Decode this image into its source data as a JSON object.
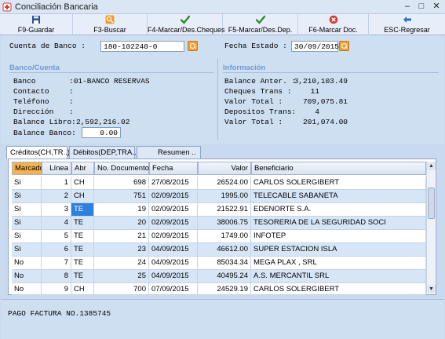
{
  "window": {
    "title": "Conciliación Bancaria",
    "minimize": "–",
    "maximize": "□",
    "close": "✕"
  },
  "toolbar": {
    "buttons": [
      {
        "label": "F9-Guardar",
        "icon": "save-icon",
        "color": "#2b4fa0"
      },
      {
        "label": "F3-Buscar",
        "icon": "search-icon",
        "color": "#f39c2a"
      },
      {
        "label": "F4-Marcar/Des.Cheques",
        "icon": "check-icon",
        "color": "#2f8a2f"
      },
      {
        "label": "F5-Marcar/Des.Dep.",
        "icon": "check-icon",
        "color": "#2f8a2f"
      },
      {
        "label": "F6-Marcar Doc.",
        "icon": "cancel-icon",
        "color": "#d33a2c"
      },
      {
        "label": "ESC-Regresar",
        "icon": "back-icon",
        "color": "#2d6ec7"
      }
    ]
  },
  "form": {
    "cuenta_label": "Cuenta de Banco  :",
    "cuenta_value": "180-102240-0",
    "fecha_label": "Fecha Estado   :",
    "fecha_value": "30/09/2015",
    "banco_section": "Banco/Cuenta",
    "info_section": "Información",
    "banco_fields": [
      {
        "label": "Banco",
        "value": ":01-BANCO RESERVAS"
      },
      {
        "label": "Contacto",
        "value": ":"
      },
      {
        "label": "Teléfono",
        "value": ":"
      },
      {
        "label": "Dirección",
        "value": ":"
      }
    ],
    "balance_libro_label": "Balance Libro:",
    "balance_libro_value": "2,592,216.02",
    "balance_banco_label": "Balance Banco:",
    "balance_banco_value": "0.00",
    "info_fields": [
      {
        "label": "Balance Anter. :",
        "value": "3,210,103.49"
      },
      {
        "label": "Cheques Trans  :",
        "value": "11"
      },
      {
        "label": "Valor Total    :",
        "value": "709,075.81"
      },
      {
        "label": "Depositos Trans:",
        "value": "4"
      },
      {
        "label": "Valor Total    :",
        "value": "201,074.00"
      }
    ]
  },
  "tabs": [
    {
      "label": "Créditos(CH,TR..)",
      "active": true
    },
    {
      "label": "Débitos(DEP,TRA..)",
      "active": false
    },
    {
      "label": "Resumen ..",
      "active": false
    }
  ],
  "grid": {
    "columns": [
      "Marcado",
      "Línea",
      "Abr",
      "No. Documento",
      "Fecha",
      "Valor",
      "Beneficiario"
    ],
    "rows": [
      [
        "Si",
        "1",
        "CH",
        "698",
        "27/08/2015",
        "26524.00",
        "CARLOS SOLERGIBERT"
      ],
      [
        "Si",
        "2",
        "CH",
        "751",
        "02/09/2015",
        "1995.00",
        "TELECABLE SABANETA"
      ],
      [
        "Si",
        "3",
        "TE",
        "19",
        "02/09/2015",
        "21522.91",
        "EDENORTE S.A."
      ],
      [
        "Si",
        "4",
        "TE",
        "20",
        "02/09/2015",
        "38006.75",
        "TESORERIA DE LA SEGURIDAD SOCI"
      ],
      [
        "Si",
        "5",
        "TE",
        "21",
        "02/09/2015",
        "1749.00",
        "INFOTEP"
      ],
      [
        "Si",
        "6",
        "TE",
        "23",
        "04/09/2015",
        "46612.00",
        "SUPER ESTACION ISLA"
      ],
      [
        "No",
        "7",
        "TE",
        "24",
        "04/09/2015",
        "85034.34",
        "MEGA PLAX , SRL"
      ],
      [
        "No",
        "8",
        "TE",
        "25",
        "04/09/2015",
        "40495.24",
        "A.S. MERCANTIL SRL"
      ],
      [
        "No",
        "9",
        "CH",
        "700",
        "07/09/2015",
        "24529.19",
        "CARLOS SOLERGIBERT"
      ]
    ],
    "footer_marks": [
      "....",
      "....",
      "....",
      "....",
      "....",
      "....",
      "...."
    ],
    "selected_row": 2
  },
  "footer": {
    "note": "PAGO FACTURA NO.1385745"
  }
}
